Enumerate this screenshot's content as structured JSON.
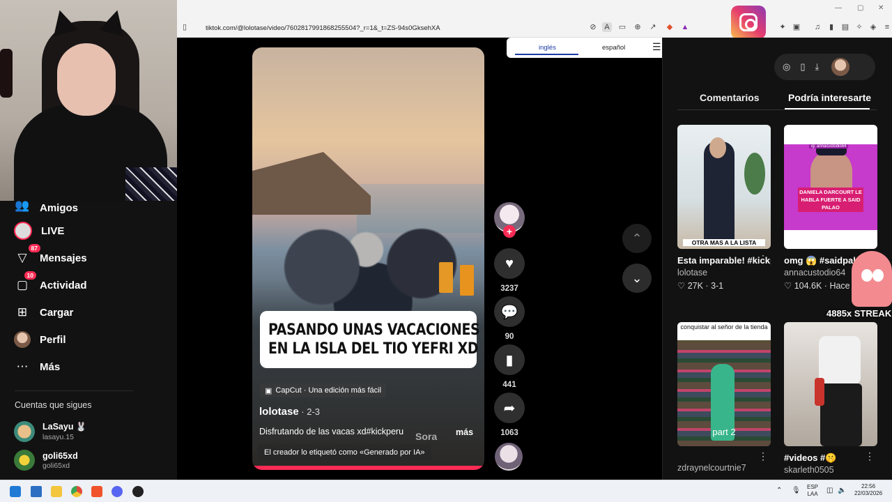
{
  "browser": {
    "url": "tiktok.com/@lolotase/video/7602817991868255504?_r=1&_t=ZS-94s0GksehXA"
  },
  "translate_popup": {
    "lang_source": "inglés",
    "lang_target": "español",
    "menu_icon": "hamburger-icon",
    "close_icon": "close-icon"
  },
  "sidebar": {
    "items": [
      {
        "label": "Amigos",
        "icon": "friends-icon"
      },
      {
        "label": "LIVE",
        "icon": "live-icon"
      },
      {
        "label": "Mensajes",
        "icon": "messages-icon",
        "badge": "87"
      },
      {
        "label": "Actividad",
        "icon": "activity-icon",
        "badge": "10"
      },
      {
        "label": "Cargar",
        "icon": "upload-icon"
      },
      {
        "label": "Perfil",
        "icon": "profile-icon"
      },
      {
        "label": "Más",
        "icon": "more-icon"
      }
    ],
    "following_header": "Cuentas que sigues",
    "following": [
      {
        "name": "LaSayu 🐰",
        "handle": "lasayu.15"
      },
      {
        "name": "goli65xd",
        "handle": "goli65xd"
      }
    ]
  },
  "video": {
    "caption_line1": "PASANDO UNAS VACACIONES",
    "caption_line2": "EN LA ISLA DEL TIO YEFRI XD",
    "capcut": "CapCut · Una edición más fácil",
    "author": "lolotase",
    "date": " · 2-3",
    "description": "Disfrutando de las vacas xd#kickperu",
    "more": "más",
    "watermark": "Sora",
    "ai_label": "El creador lo etiquetó como «Generado por IA»"
  },
  "actions": {
    "likes": "3237",
    "comments": "90",
    "saves": "441",
    "shares": "1063"
  },
  "right_panel": {
    "tabs": [
      "Comentarios",
      "Podría interesarte"
    ],
    "active_tab": "Podría interesarte",
    "cards": [
      {
        "title": "Esta imparable! #kickperu...",
        "author": "lolotase",
        "likes": "27K",
        "date": "3-1",
        "thumb_text": "OTRA MAS A LA LISTA"
      },
      {
        "title": "omg 😱 #saidpalao...",
        "author": "annacustodio64",
        "likes": "104.6K",
        "date": "Hace",
        "thumb_text": "DANIELA DARCOURT LE HABLA FUERTE A SAID PALAO",
        "thumb_tag": "ig: annacustodio64"
      },
      {
        "title": "",
        "author": "zdraynelcourtnie7",
        "thumb_text": "conquistar al señor de la tienda",
        "thumb_sub": "part 2"
      },
      {
        "title": "#videos #🤫",
        "author": "skarleth0505"
      }
    ]
  },
  "overlay": {
    "streak": "4885x STREAK"
  },
  "taskbar": {
    "lang1": "ESP",
    "lang2": "LAA",
    "time": "22:56",
    "date": "22/03/2026"
  },
  "colors": {
    "accent": "#fe2c55",
    "background": "#000000",
    "panel": "#121212"
  }
}
